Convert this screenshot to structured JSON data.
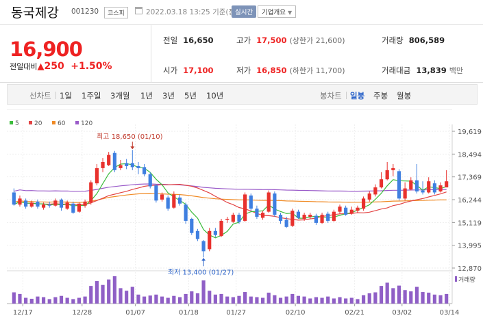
{
  "header": {
    "name": "동국제강",
    "code": "001230",
    "market": "코스피",
    "datetime": "2022.03.18 13:25",
    "basis": "기준(장중)",
    "realtime": "실시간",
    "company_info": "기업개요"
  },
  "quote": {
    "price": "16,900",
    "change_label": "전일대비",
    "change_value": "250",
    "change_rate": "+1.50%",
    "items": [
      {
        "label": "전일",
        "value": "16,650",
        "sub": ""
      },
      {
        "label": "고가",
        "value": "17,500",
        "sub": "(상한가 21,600)"
      },
      {
        "label": "거래량",
        "value": "806,589",
        "sub": ""
      },
      {
        "label": "시가",
        "value": "17,100",
        "sub": ""
      },
      {
        "label": "저가",
        "value": "16,850",
        "sub": "(하한가 11,700)"
      },
      {
        "label": "거래대금",
        "value": "13,839",
        "sub": "백만"
      }
    ]
  },
  "tabs": {
    "line_chart": "선차트",
    "periods": [
      "1일",
      "1주일",
      "3개월",
      "1년",
      "3년",
      "5년",
      "10년"
    ],
    "candle_chart": "봉차트",
    "candle_types": [
      "일봉",
      "주봉",
      "월봉"
    ]
  },
  "colors": {
    "up": "#e8312d",
    "down": "#3f7fe0",
    "ma5": "#3cbc3c",
    "ma20": "#e34444",
    "ma60": "#f08a24",
    "ma120": "#9a5bc9",
    "volume": "#8f5fc6"
  },
  "chart_data": {
    "type": "candlestick",
    "legend": [
      "5",
      "20",
      "60",
      "120"
    ],
    "y_ticks": [
      "19,619",
      "18,494",
      "17,369",
      "16,244",
      "15,119",
      "13,995",
      "12,870"
    ],
    "x_ticks": [
      "12/17",
      "12/28",
      "01/07",
      "01/18",
      "01/27",
      "02/10",
      "02/21",
      "03/02",
      "03/14"
    ],
    "ylim": [
      12870,
      19619
    ],
    "high_annotation": "최고 18,650 (01/10)",
    "low_annotation": "최저 13,400 (01/27)",
    "volume_label": "거래량",
    "candles": [
      [
        16600,
        16000,
        16800,
        15950
      ],
      [
        16000,
        16300,
        16450,
        15900
      ],
      [
        16200,
        15900,
        16300,
        15800
      ],
      [
        15900,
        16100,
        16200,
        15850
      ],
      [
        16150,
        15900,
        16250,
        15800
      ],
      [
        15850,
        16000,
        16100,
        15750
      ],
      [
        16000,
        15950,
        16150,
        15850
      ],
      [
        15950,
        16200,
        16300,
        15900
      ],
      [
        16250,
        15850,
        16300,
        15700
      ],
      [
        15800,
        16100,
        16200,
        15750
      ],
      [
        16050,
        15600,
        16150,
        15550
      ],
      [
        15650,
        16050,
        16100,
        15600
      ],
      [
        15950,
        16150,
        16250,
        15850
      ],
      [
        16100,
        17100,
        17200,
        16000
      ],
      [
        17050,
        17800,
        18000,
        16950
      ],
      [
        17800,
        18100,
        18300,
        17600
      ],
      [
        17950,
        18450,
        18600,
        17900
      ],
      [
        18550,
        17700,
        18650,
        17600
      ],
      [
        17800,
        17950,
        18200,
        17700
      ],
      [
        18050,
        17900,
        18250,
        17750
      ],
      [
        18050,
        17850,
        18700,
        17700
      ],
      [
        17900,
        17800,
        18100,
        17500
      ],
      [
        17850,
        17500,
        18000,
        17400
      ],
      [
        17500,
        16900,
        17600,
        16800
      ],
      [
        16950,
        16200,
        17000,
        16100
      ],
      [
        16250,
        16500,
        16600,
        16150
      ],
      [
        16350,
        15800,
        16450,
        15700
      ],
      [
        15850,
        16500,
        16650,
        15800
      ],
      [
        16350,
        16050,
        16500,
        15950
      ],
      [
        16000,
        15200,
        16100,
        15050
      ],
      [
        15300,
        14600,
        15350,
        14500
      ],
      [
        14700,
        14300,
        14800,
        14200
      ],
      [
        14200,
        13700,
        14250,
        13400
      ],
      [
        13800,
        14700,
        14850,
        13700
      ],
      [
        14700,
        14500,
        14850,
        14400
      ],
      [
        14450,
        15200,
        15300,
        14400
      ],
      [
        15250,
        15300,
        15400,
        15100
      ],
      [
        15150,
        15500,
        15600,
        15100
      ],
      [
        15500,
        15150,
        15600,
        15050
      ],
      [
        15200,
        16500,
        16600,
        15150
      ],
      [
        16450,
        15800,
        16550,
        15700
      ],
      [
        15800,
        15400,
        15950,
        15300
      ],
      [
        15350,
        15600,
        15700,
        15250
      ],
      [
        15650,
        16600,
        16700,
        15600
      ],
      [
        16550,
        15500,
        16650,
        15400
      ],
      [
        15500,
        15200,
        15600,
        15050
      ],
      [
        15250,
        14900,
        15400,
        14850
      ],
      [
        14950,
        15700,
        15800,
        14900
      ],
      [
        15650,
        15350,
        15750,
        15300
      ],
      [
        15300,
        15500,
        15600,
        15200
      ],
      [
        15400,
        15500,
        15600,
        15300
      ],
      [
        15450,
        15100,
        15550,
        15000
      ],
      [
        15100,
        15500,
        15600,
        15050
      ],
      [
        15550,
        15200,
        15650,
        15100
      ],
      [
        15200,
        15650,
        15750,
        15150
      ],
      [
        15650,
        15900,
        16000,
        15550
      ],
      [
        15850,
        15500,
        15950,
        15450
      ],
      [
        15550,
        15750,
        15900,
        15500
      ],
      [
        15700,
        15850,
        15950,
        15600
      ],
      [
        15800,
        16300,
        16400,
        15700
      ],
      [
        16250,
        16550,
        16650,
        16150
      ],
      [
        16500,
        16850,
        17000,
        16400
      ],
      [
        16850,
        17250,
        17600,
        16800
      ],
      [
        17250,
        17700,
        18100,
        17200
      ],
      [
        17700,
        17800,
        18000,
        17400
      ],
      [
        17650,
        16300,
        17750,
        16200
      ],
      [
        16300,
        16800,
        17100,
        16200
      ],
      [
        16750,
        17200,
        17350,
        16700
      ],
      [
        17200,
        16650,
        18000,
        16550
      ],
      [
        16700,
        16600,
        17150,
        16500
      ],
      [
        16600,
        17150,
        17350,
        16550
      ],
      [
        17050,
        16600,
        17200,
        16500
      ],
      [
        16650,
        16950,
        17100,
        16600
      ],
      [
        16850,
        17150,
        17700,
        16850
      ]
    ],
    "volumes": [
      35,
      30,
      18,
      15,
      22,
      20,
      14,
      20,
      24,
      18,
      14,
      18,
      22,
      55,
      70,
      58,
      75,
      85,
      48,
      40,
      52,
      28,
      22,
      25,
      28,
      22,
      18,
      24,
      20,
      30,
      38,
      32,
      72,
      40,
      28,
      30,
      22,
      20,
      24,
      36,
      22,
      20,
      18,
      34,
      26,
      18,
      22,
      30,
      24,
      22,
      16,
      20,
      18,
      22,
      16,
      20,
      16,
      18,
      14,
      26,
      32,
      35,
      55,
      65,
      48,
      56,
      42,
      38,
      52,
      36,
      34,
      28,
      26,
      30
    ]
  }
}
